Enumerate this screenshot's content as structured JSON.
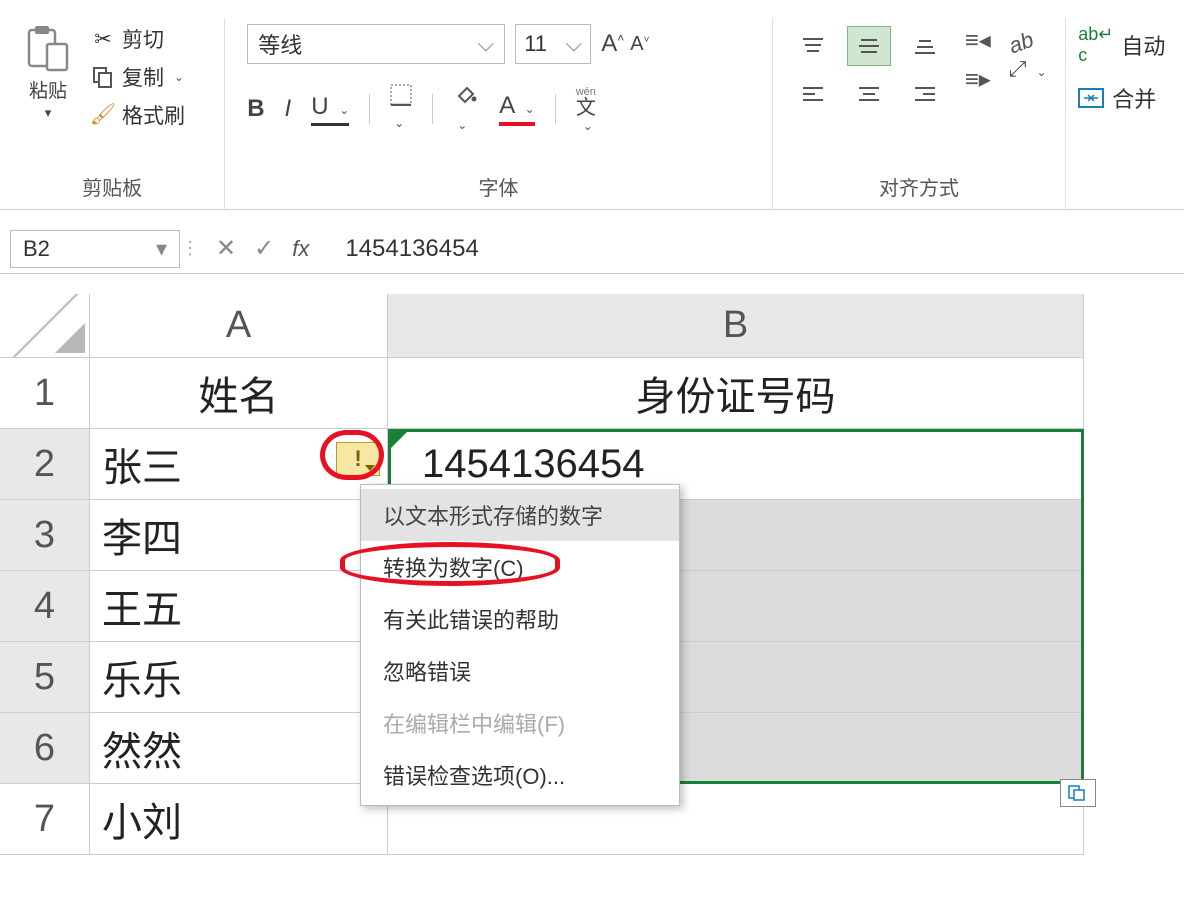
{
  "ribbon": {
    "clipboard": {
      "paste": "粘贴",
      "cut": "剪切",
      "copy": "复制",
      "format_painter": "格式刷",
      "group": "剪贴板"
    },
    "font": {
      "name": "等线",
      "size": "11",
      "bold": "B",
      "italic": "I",
      "underline": "U",
      "wen": "wén",
      "wen_char": "文",
      "group": "字体"
    },
    "align": {
      "orientation_icon": "ab",
      "group": "对齐方式"
    },
    "wrap": {
      "auto": "自动",
      "merge": "合并"
    }
  },
  "formula_bar": {
    "cell_ref": "B2",
    "fx": "fx",
    "value": "1454136454"
  },
  "columns": {
    "A": "A",
    "B": "B"
  },
  "rows": [
    "1",
    "2",
    "3",
    "4",
    "5",
    "6",
    "7"
  ],
  "data": {
    "A1": "姓名",
    "B1": "身份证号码",
    "A2": "张三",
    "B2": "1454136454",
    "A3": "李四",
    "A4": "王五",
    "A5": "乐乐",
    "A6": "然然",
    "A7": "小刘"
  },
  "context_menu": {
    "header": "以文本形式存储的数字",
    "convert": "转换为数字(C)",
    "help": "有关此错误的帮助",
    "ignore": "忽略错误",
    "edit": "在编辑栏中编辑(F)",
    "options": "错误检查选项(O)..."
  },
  "smart_tag_char": "!"
}
